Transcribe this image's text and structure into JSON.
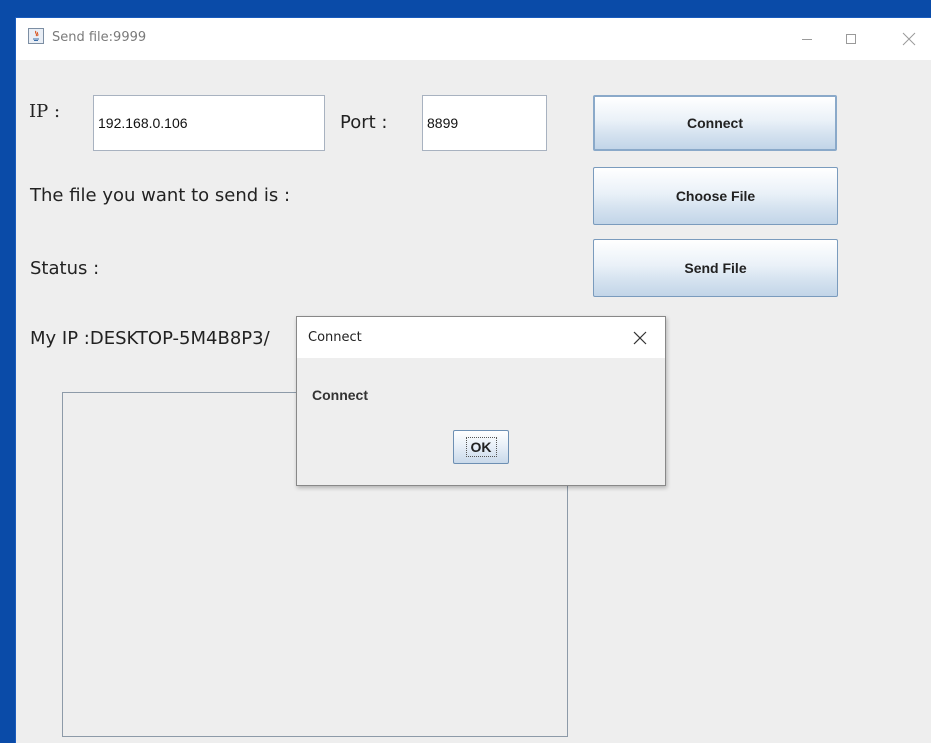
{
  "window": {
    "title": "Send file:9999",
    "app_icon": "java-app-icon",
    "controls": [
      "minimize-icon",
      "maximize-icon",
      "close-icon"
    ]
  },
  "form": {
    "ip_label": "IP :",
    "ip_value": "192.168.0.106",
    "port_label": "Port :",
    "port_value": "8899",
    "file_label": "The file you want to send is :",
    "status_label": "Status :",
    "my_ip_label": "My IP :DESKTOP-5M4B8P3/"
  },
  "buttons": {
    "connect": "Connect",
    "choose_file": "Choose File",
    "send_file": "Send File"
  },
  "dialog": {
    "title": "Connect",
    "message": "Connect",
    "ok_label": "OK"
  },
  "colors": {
    "desktop": "#0a4ba8",
    "window_bg": "#eeeeee",
    "button_border": "#7a9bbd"
  }
}
